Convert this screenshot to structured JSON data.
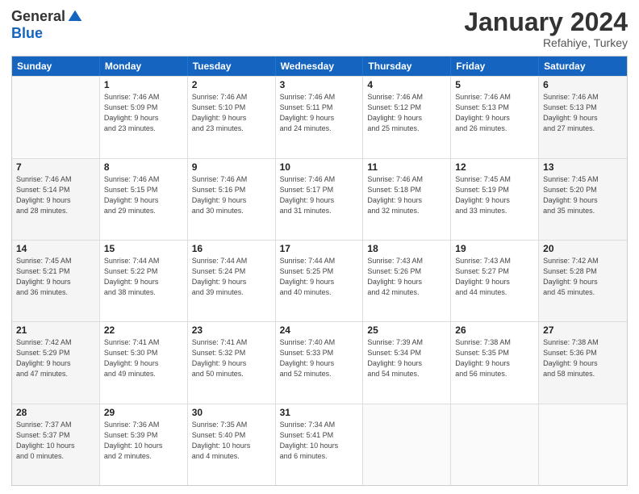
{
  "header": {
    "logo_general": "General",
    "logo_blue": "Blue",
    "month_title": "January 2024",
    "subtitle": "Refahiye, Turkey"
  },
  "days_of_week": [
    "Sunday",
    "Monday",
    "Tuesday",
    "Wednesday",
    "Thursday",
    "Friday",
    "Saturday"
  ],
  "weeks": [
    {
      "days": [
        {
          "number": "",
          "info": "",
          "empty": true
        },
        {
          "number": "1",
          "info": "Sunrise: 7:46 AM\nSunset: 5:09 PM\nDaylight: 9 hours\nand 23 minutes."
        },
        {
          "number": "2",
          "info": "Sunrise: 7:46 AM\nSunset: 5:10 PM\nDaylight: 9 hours\nand 23 minutes."
        },
        {
          "number": "3",
          "info": "Sunrise: 7:46 AM\nSunset: 5:11 PM\nDaylight: 9 hours\nand 24 minutes."
        },
        {
          "number": "4",
          "info": "Sunrise: 7:46 AM\nSunset: 5:12 PM\nDaylight: 9 hours\nand 25 minutes."
        },
        {
          "number": "5",
          "info": "Sunrise: 7:46 AM\nSunset: 5:13 PM\nDaylight: 9 hours\nand 26 minutes."
        },
        {
          "number": "6",
          "info": "Sunrise: 7:46 AM\nSunset: 5:13 PM\nDaylight: 9 hours\nand 27 minutes."
        }
      ]
    },
    {
      "days": [
        {
          "number": "7",
          "info": "Sunrise: 7:46 AM\nSunset: 5:14 PM\nDaylight: 9 hours\nand 28 minutes."
        },
        {
          "number": "8",
          "info": "Sunrise: 7:46 AM\nSunset: 5:15 PM\nDaylight: 9 hours\nand 29 minutes."
        },
        {
          "number": "9",
          "info": "Sunrise: 7:46 AM\nSunset: 5:16 PM\nDaylight: 9 hours\nand 30 minutes."
        },
        {
          "number": "10",
          "info": "Sunrise: 7:46 AM\nSunset: 5:17 PM\nDaylight: 9 hours\nand 31 minutes."
        },
        {
          "number": "11",
          "info": "Sunrise: 7:46 AM\nSunset: 5:18 PM\nDaylight: 9 hours\nand 32 minutes."
        },
        {
          "number": "12",
          "info": "Sunrise: 7:45 AM\nSunset: 5:19 PM\nDaylight: 9 hours\nand 33 minutes."
        },
        {
          "number": "13",
          "info": "Sunrise: 7:45 AM\nSunset: 5:20 PM\nDaylight: 9 hours\nand 35 minutes."
        }
      ]
    },
    {
      "days": [
        {
          "number": "14",
          "info": "Sunrise: 7:45 AM\nSunset: 5:21 PM\nDaylight: 9 hours\nand 36 minutes."
        },
        {
          "number": "15",
          "info": "Sunrise: 7:44 AM\nSunset: 5:22 PM\nDaylight: 9 hours\nand 38 minutes."
        },
        {
          "number": "16",
          "info": "Sunrise: 7:44 AM\nSunset: 5:24 PM\nDaylight: 9 hours\nand 39 minutes."
        },
        {
          "number": "17",
          "info": "Sunrise: 7:44 AM\nSunset: 5:25 PM\nDaylight: 9 hours\nand 40 minutes."
        },
        {
          "number": "18",
          "info": "Sunrise: 7:43 AM\nSunset: 5:26 PM\nDaylight: 9 hours\nand 42 minutes."
        },
        {
          "number": "19",
          "info": "Sunrise: 7:43 AM\nSunset: 5:27 PM\nDaylight: 9 hours\nand 44 minutes."
        },
        {
          "number": "20",
          "info": "Sunrise: 7:42 AM\nSunset: 5:28 PM\nDaylight: 9 hours\nand 45 minutes."
        }
      ]
    },
    {
      "days": [
        {
          "number": "21",
          "info": "Sunrise: 7:42 AM\nSunset: 5:29 PM\nDaylight: 9 hours\nand 47 minutes."
        },
        {
          "number": "22",
          "info": "Sunrise: 7:41 AM\nSunset: 5:30 PM\nDaylight: 9 hours\nand 49 minutes."
        },
        {
          "number": "23",
          "info": "Sunrise: 7:41 AM\nSunset: 5:32 PM\nDaylight: 9 hours\nand 50 minutes."
        },
        {
          "number": "24",
          "info": "Sunrise: 7:40 AM\nSunset: 5:33 PM\nDaylight: 9 hours\nand 52 minutes."
        },
        {
          "number": "25",
          "info": "Sunrise: 7:39 AM\nSunset: 5:34 PM\nDaylight: 9 hours\nand 54 minutes."
        },
        {
          "number": "26",
          "info": "Sunrise: 7:38 AM\nSunset: 5:35 PM\nDaylight: 9 hours\nand 56 minutes."
        },
        {
          "number": "27",
          "info": "Sunrise: 7:38 AM\nSunset: 5:36 PM\nDaylight: 9 hours\nand 58 minutes."
        }
      ]
    },
    {
      "days": [
        {
          "number": "28",
          "info": "Sunrise: 7:37 AM\nSunset: 5:37 PM\nDaylight: 10 hours\nand 0 minutes."
        },
        {
          "number": "29",
          "info": "Sunrise: 7:36 AM\nSunset: 5:39 PM\nDaylight: 10 hours\nand 2 minutes."
        },
        {
          "number": "30",
          "info": "Sunrise: 7:35 AM\nSunset: 5:40 PM\nDaylight: 10 hours\nand 4 minutes."
        },
        {
          "number": "31",
          "info": "Sunrise: 7:34 AM\nSunset: 5:41 PM\nDaylight: 10 hours\nand 6 minutes."
        },
        {
          "number": "",
          "info": "",
          "empty": true
        },
        {
          "number": "",
          "info": "",
          "empty": true
        },
        {
          "number": "",
          "info": "",
          "empty": true
        }
      ]
    }
  ]
}
